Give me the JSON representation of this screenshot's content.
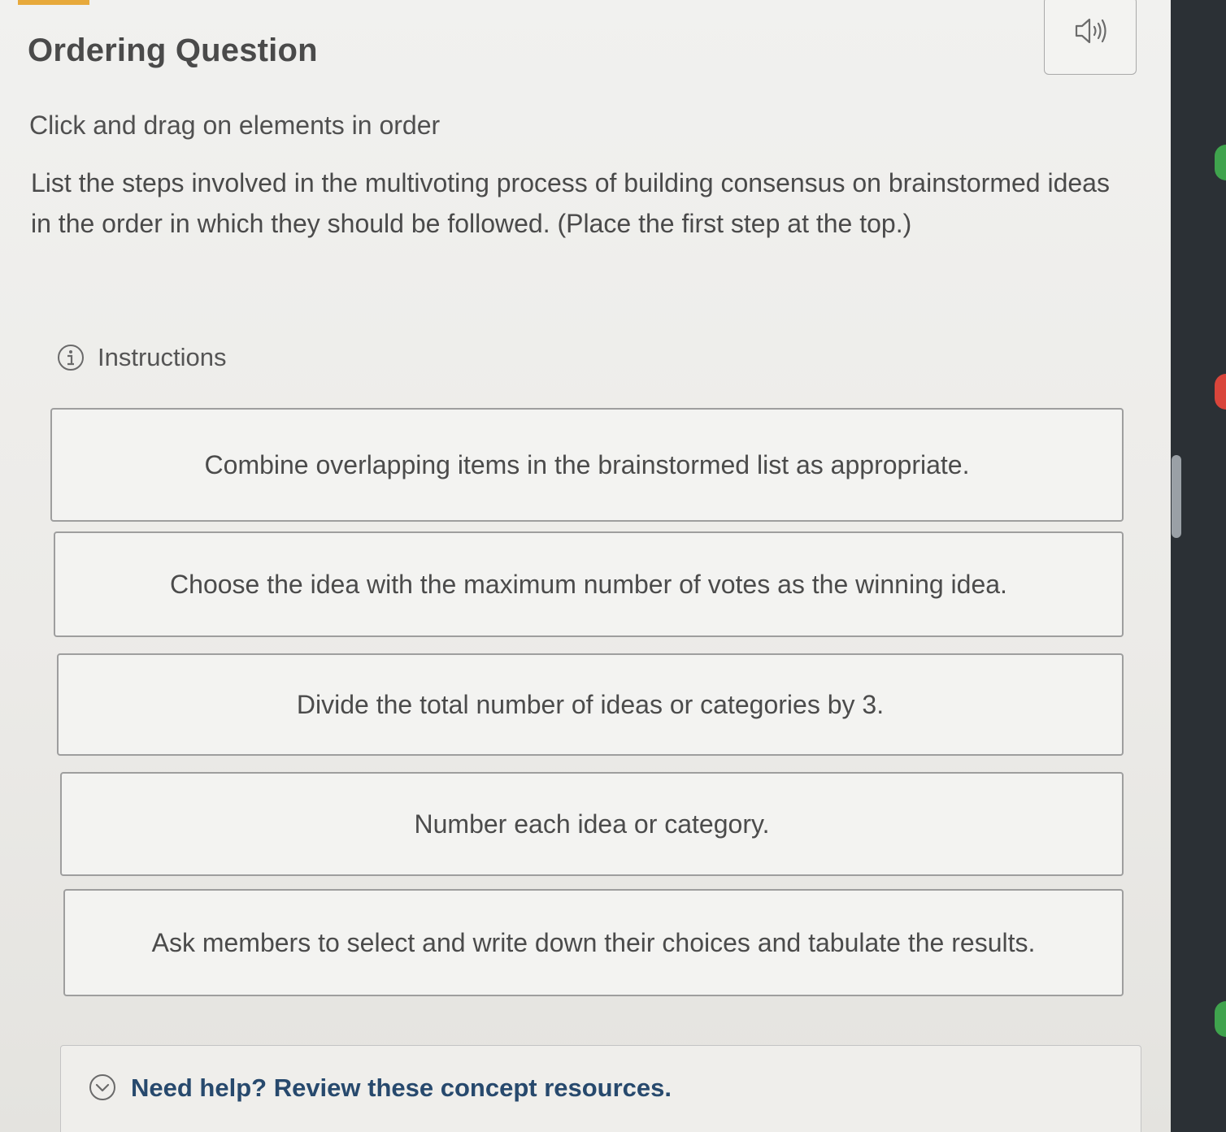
{
  "page": {
    "title": "Ordering Question",
    "subtitle": "Click and drag on elements in order",
    "prompt": "List the steps involved in the multivoting process of building consensus on brainstormed ideas in the order in which they should be followed. (Place the first step at the top.)"
  },
  "toolbar": {
    "audio_icon": "speaker-icon"
  },
  "instructions": {
    "label": "Instructions",
    "icon": "info-icon"
  },
  "ordering": {
    "items": [
      "Combine overlapping items in the brainstormed list as appropriate.",
      "Choose the idea with the maximum number of votes as the winning idea.",
      "Divide the total number of ideas or categories by 3.",
      "Number each idea or category.",
      "Ask members to select and write down their choices and tabulate the results."
    ]
  },
  "help": {
    "label": "Need help? Review these concept resources.",
    "icon": "chevron-down-circle-icon"
  },
  "colors": {
    "panel_background": "#ecebe8",
    "text": "#4a4a4a",
    "help_link": "#27496d",
    "item_border": "#9e9e9e",
    "accent": "#e7a93b"
  }
}
